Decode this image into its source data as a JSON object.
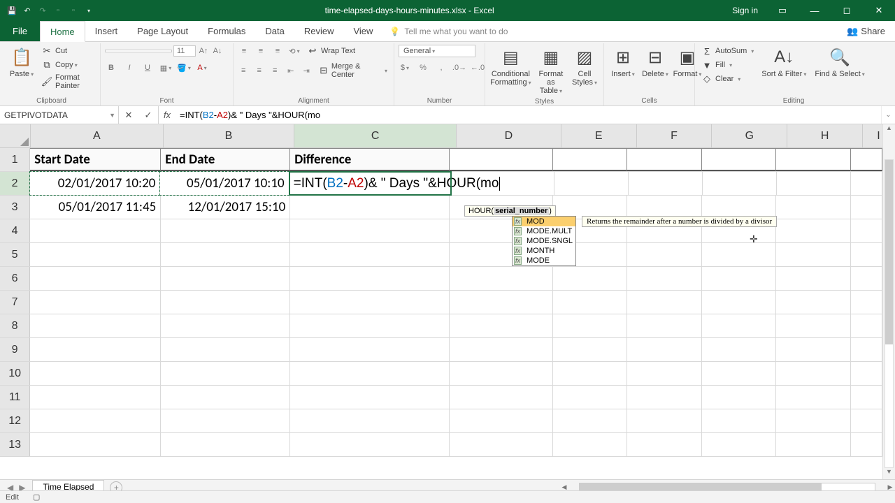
{
  "title": "time-elapsed-days-hours-minutes.xlsx - Excel",
  "signin": "Sign in",
  "tabs": {
    "file": "File",
    "home": "Home",
    "insert": "Insert",
    "page": "Page Layout",
    "formulas": "Formulas",
    "data": "Data",
    "review": "Review",
    "view": "View",
    "tell": "Tell me what you want to do",
    "share": "Share"
  },
  "ribbon": {
    "clipboard": {
      "label": "Clipboard",
      "paste": "Paste",
      "cut": "Cut",
      "copy": "Copy",
      "painter": "Format Painter"
    },
    "font": {
      "label": "Font",
      "name": "",
      "size": "11"
    },
    "alignment": {
      "label": "Alignment",
      "wrap": "Wrap Text",
      "merge": "Merge & Center"
    },
    "number": {
      "label": "Number",
      "format": "General"
    },
    "styles": {
      "label": "Styles",
      "cond": "Conditional Formatting",
      "table": "Format as Table",
      "cell": "Cell Styles"
    },
    "cells": {
      "label": "Cells",
      "insert": "Insert",
      "delete": "Delete",
      "format": "Format"
    },
    "editing": {
      "label": "Editing",
      "sum": "AutoSum",
      "fill": "Fill",
      "clear": "Clear",
      "sort": "Sort & Filter",
      "find": "Find & Select"
    }
  },
  "namebox": "GETPIVOTDATA",
  "formula_plain": "=INT(B2-A2)& \" Days \"&HOUR(mo",
  "formula": {
    "p1": "=INT(",
    "b2": "B2",
    "dash": "-",
    "a2": "A2",
    "p2": ")& \" Days \"&HOUR(mo"
  },
  "func_tip": {
    "name": "HOUR(",
    "arg": "serial_number",
    "close": ")"
  },
  "ac": {
    "items": [
      "MOD",
      "MODE.MULT",
      "MODE.SNGL",
      "MONTH",
      "MODE"
    ],
    "desc": "Returns the remainder after a number is divided by a divisor"
  },
  "cols": [
    "A",
    "B",
    "C",
    "D",
    "E",
    "F",
    "G",
    "H",
    "I"
  ],
  "rows": [
    1,
    2,
    3,
    4,
    5,
    6,
    7,
    8,
    9,
    10,
    11,
    12,
    13
  ],
  "data": {
    "headers": {
      "A": "Start Date",
      "B": "End Date",
      "C": "Difference"
    },
    "r2": {
      "A": "02/01/2017 10:20",
      "B": "05/01/2017 10:10"
    },
    "r3": {
      "A": "05/01/2017 11:45",
      "B": "12/01/2017 15:10"
    }
  },
  "sheet": "Time Elapsed",
  "status": "Edit"
}
